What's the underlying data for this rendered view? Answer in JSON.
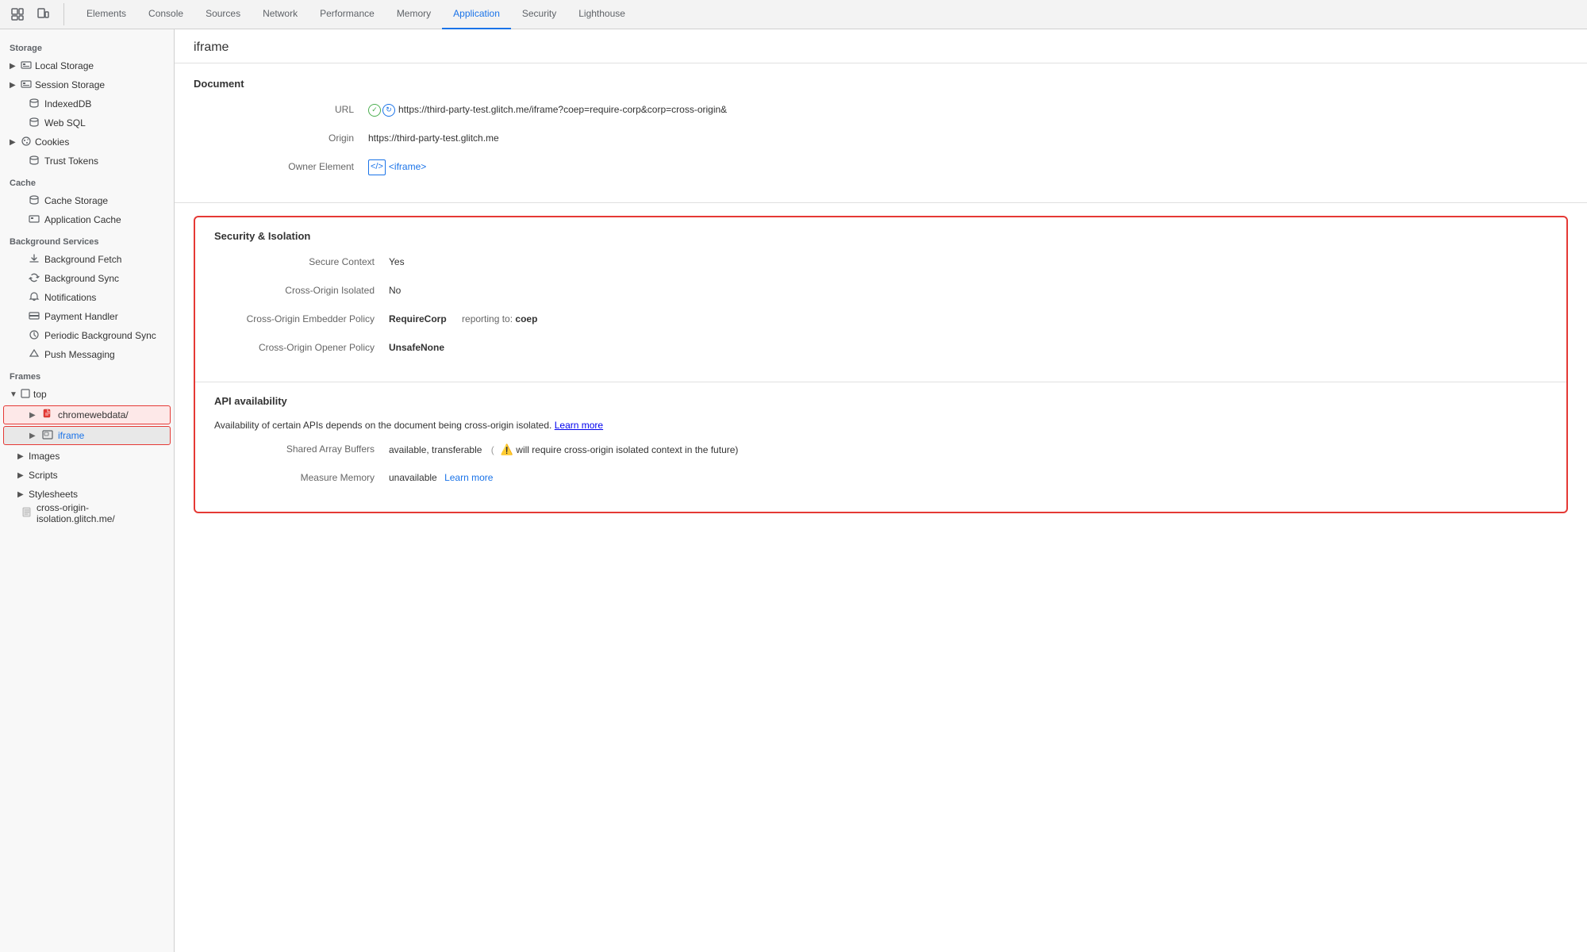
{
  "toolbar": {
    "inspect_icon": "⊡",
    "device_icon": "⬜",
    "tabs": [
      {
        "label": "Elements",
        "active": false
      },
      {
        "label": "Console",
        "active": false
      },
      {
        "label": "Sources",
        "active": false
      },
      {
        "label": "Network",
        "active": false
      },
      {
        "label": "Performance",
        "active": false
      },
      {
        "label": "Memory",
        "active": false
      },
      {
        "label": "Application",
        "active": true
      },
      {
        "label": "Security",
        "active": false
      },
      {
        "label": "Lighthouse",
        "active": false
      }
    ]
  },
  "sidebar": {
    "storage_label": "Storage",
    "local_storage": "Local Storage",
    "session_storage": "Session Storage",
    "indexed_db": "IndexedDB",
    "web_sql": "Web SQL",
    "cookies": "Cookies",
    "trust_tokens": "Trust Tokens",
    "cache_label": "Cache",
    "cache_storage": "Cache Storage",
    "application_cache": "Application Cache",
    "bg_services_label": "Background Services",
    "bg_fetch": "Background Fetch",
    "bg_sync": "Background Sync",
    "notifications": "Notifications",
    "payment_handler": "Payment Handler",
    "periodic_bg_sync": "Periodic Background Sync",
    "push_messaging": "Push Messaging",
    "frames_label": "Frames",
    "frame_top": "top",
    "frame_chromewebdata": "chromewebdata/",
    "frame_iframe": "iframe",
    "frame_images": "Images",
    "frame_scripts": "Scripts",
    "frame_stylesheets": "Stylesheets",
    "frame_crossorigin": "cross-origin-isolation.glitch.me/"
  },
  "main": {
    "page_title": "iframe",
    "document_section": "Document",
    "url_label": "URL",
    "url_value": "https://third-party-test.glitch.me/iframe?coep=require-corp&corp=cross-origin&",
    "origin_label": "Origin",
    "origin_value": "https://third-party-test.glitch.me",
    "owner_label": "Owner Element",
    "owner_value": "<iframe>",
    "security_section": "Security & Isolation",
    "secure_context_label": "Secure Context",
    "secure_context_value": "Yes",
    "cross_origin_isolated_label": "Cross-Origin Isolated",
    "cross_origin_isolated_value": "No",
    "coep_label": "Cross-Origin Embedder Policy",
    "coep_value": "RequireCorp",
    "coep_reporting": "reporting to:",
    "coep_reporting_value": "coep",
    "coop_label": "Cross-Origin Opener Policy",
    "coop_value": "UnsafeNone",
    "api_section": "API availability",
    "api_desc": "Availability of certain APIs depends on the document being cross-origin isolated.",
    "api_learn_more": "Learn more",
    "shared_buffers_label": "Shared Array Buffers",
    "shared_buffers_value": "available, transferable",
    "shared_buffers_warning": "⚠",
    "shared_buffers_note": "will require cross-origin isolated context in the future)",
    "measure_memory_label": "Measure Memory",
    "measure_memory_value": "unavailable",
    "measure_memory_learn": "Learn more"
  }
}
